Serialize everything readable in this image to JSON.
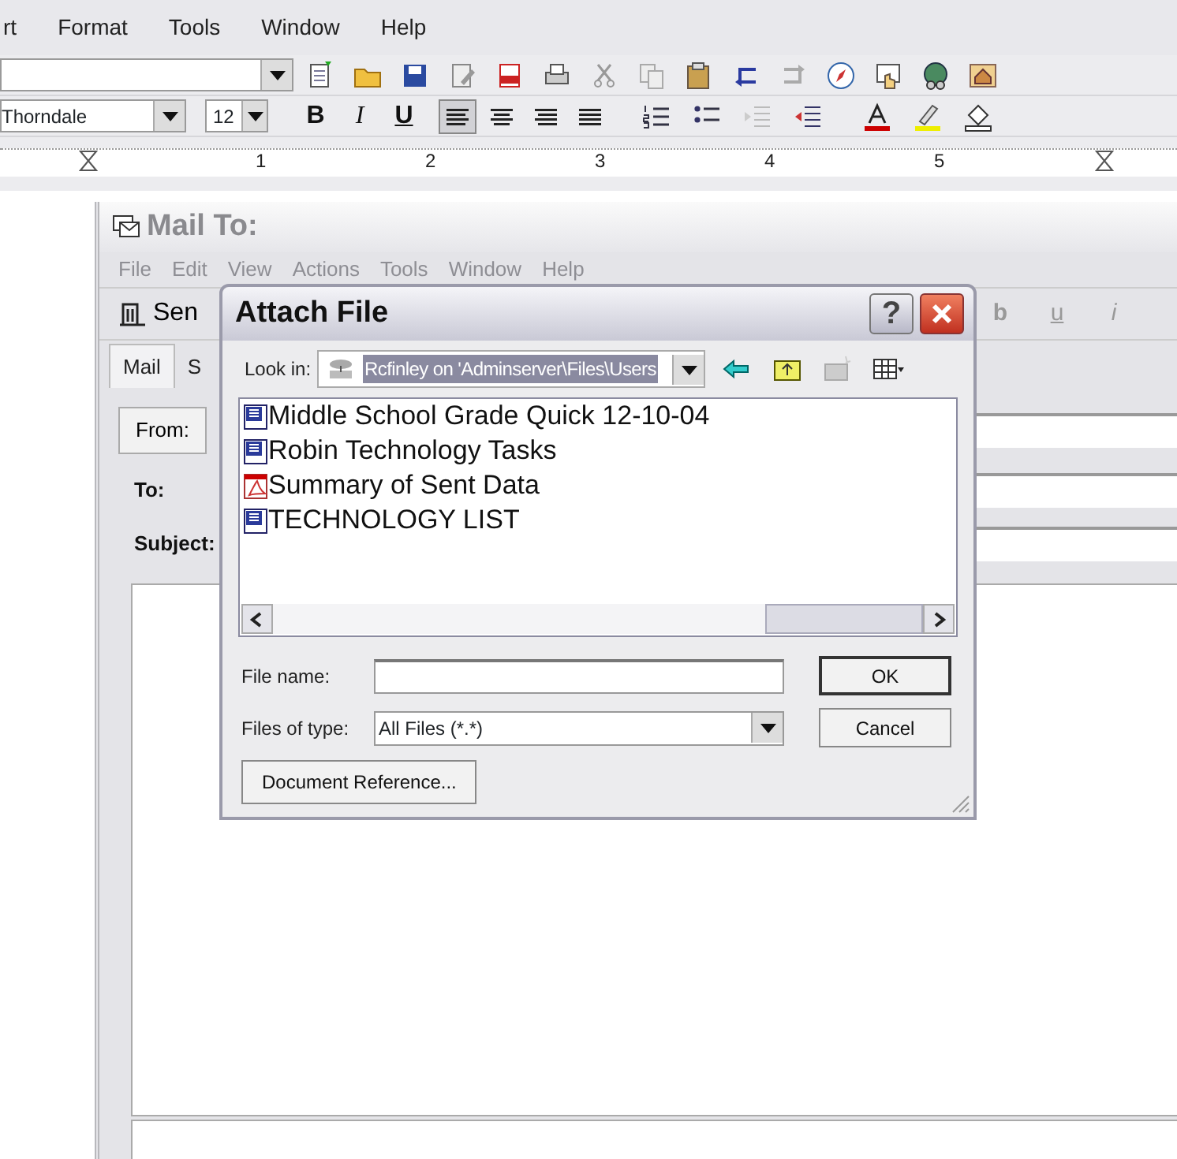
{
  "app_menu": [
    {
      "label": "rt"
    },
    {
      "label": "Format"
    },
    {
      "label": "Tools"
    },
    {
      "label": "Window"
    },
    {
      "label": "Help"
    }
  ],
  "font_name": "Thorndale",
  "font_size": "12",
  "format_buttons": [
    {
      "label": "B"
    },
    {
      "label": "I"
    },
    {
      "label": "U"
    }
  ],
  "align_buttons": [
    {
      "selected": true
    },
    {
      "selected": false
    },
    {
      "selected": false
    },
    {
      "selected": false
    }
  ],
  "ruler_numbers": [
    "1",
    "2",
    "3",
    "4",
    "5"
  ],
  "mail": {
    "title": "Mail To:",
    "menu": [
      {
        "label": "File"
      },
      {
        "label": "Edit"
      },
      {
        "label": "View"
      },
      {
        "label": "Actions"
      },
      {
        "label": "Tools"
      },
      {
        "label": "Window"
      },
      {
        "label": "Help"
      }
    ],
    "send_label": "Sen",
    "style_buttons": [
      "b",
      "u",
      "i"
    ],
    "tabs": [
      {
        "label": "Mail",
        "selected": true
      },
      {
        "label": "S",
        "selected": false
      }
    ],
    "from_label": "From:",
    "to_label": "To:",
    "subject_label": "Subject:"
  },
  "dialog": {
    "title": "Attach File",
    "help_glyph": "?",
    "look_in_label": "Look in:",
    "look_in_value": "Rcfinley on 'Adminserver\\Files\\Users",
    "files": [
      {
        "name": "Middle School Grade Quick 12-10-04",
        "kind": "word"
      },
      {
        "name": "Robin Technology Tasks",
        "kind": "word"
      },
      {
        "name": "Summary of Sent Data",
        "kind": "pdf"
      },
      {
        "name": "TECHNOLOGY LIST",
        "kind": "word"
      }
    ],
    "file_name_label": "File name:",
    "file_type_label": "Files of type:",
    "file_type_value": "All Files (*.*)",
    "ok_label": "OK",
    "cancel_label": "Cancel",
    "doc_ref_label": "Document Reference..."
  }
}
